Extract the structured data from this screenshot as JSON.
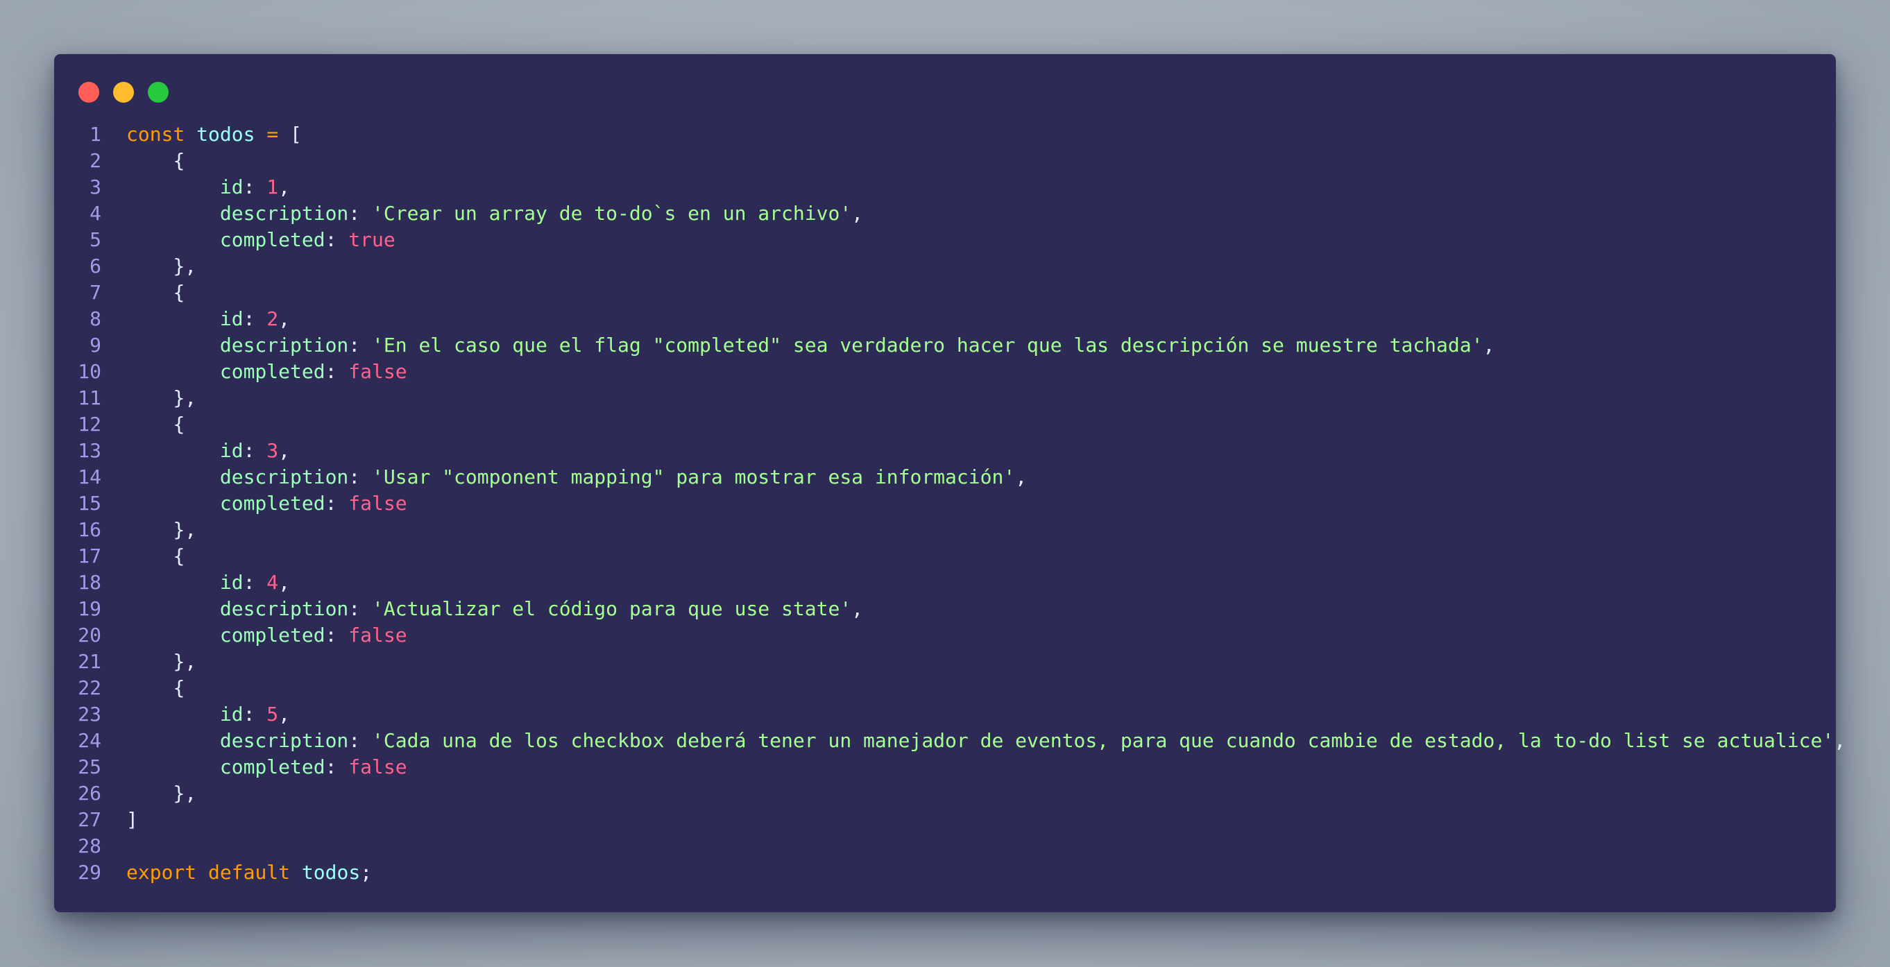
{
  "window": {
    "controls": [
      {
        "name": "close-dot",
        "color": "#ff5f56"
      },
      {
        "name": "minimize-dot",
        "color": "#ffbd2e"
      },
      {
        "name": "maximize-dot",
        "color": "#27c93f"
      }
    ]
  },
  "colors": {
    "background": "#2d2a55",
    "keyword": "#ff9d00",
    "identifier": "#9effff",
    "property": "#9effbb",
    "string": "#a5ff90",
    "number": "#ff628c",
    "line_number": "#a599e9"
  },
  "code": {
    "lines": [
      {
        "n": "1",
        "tokens": [
          [
            "keyword",
            "const"
          ],
          [
            "plain",
            " "
          ],
          [
            "ident",
            "todos"
          ],
          [
            "plain",
            " "
          ],
          [
            "op",
            "="
          ],
          [
            "plain",
            " "
          ],
          [
            "punct",
            "["
          ]
        ]
      },
      {
        "n": "2",
        "tokens": [
          [
            "plain",
            "    "
          ],
          [
            "punct",
            "{"
          ]
        ]
      },
      {
        "n": "3",
        "tokens": [
          [
            "plain",
            "        "
          ],
          [
            "prop",
            "id"
          ],
          [
            "punct",
            ": "
          ],
          [
            "number",
            "1"
          ],
          [
            "punct",
            ","
          ]
        ]
      },
      {
        "n": "4",
        "tokens": [
          [
            "plain",
            "        "
          ],
          [
            "prop",
            "description"
          ],
          [
            "punct",
            ": "
          ],
          [
            "string",
            "'Crear un array de to-do`s en un archivo'"
          ],
          [
            "punct",
            ","
          ]
        ]
      },
      {
        "n": "5",
        "tokens": [
          [
            "plain",
            "        "
          ],
          [
            "prop",
            "completed"
          ],
          [
            "punct",
            ": "
          ],
          [
            "bool",
            "true"
          ]
        ]
      },
      {
        "n": "6",
        "tokens": [
          [
            "plain",
            "    "
          ],
          [
            "punct",
            "},"
          ]
        ]
      },
      {
        "n": "7",
        "tokens": [
          [
            "plain",
            "    "
          ],
          [
            "punct",
            "{"
          ]
        ]
      },
      {
        "n": "8",
        "tokens": [
          [
            "plain",
            "        "
          ],
          [
            "prop",
            "id"
          ],
          [
            "punct",
            ": "
          ],
          [
            "number",
            "2"
          ],
          [
            "punct",
            ","
          ]
        ]
      },
      {
        "n": "9",
        "tokens": [
          [
            "plain",
            "        "
          ],
          [
            "prop",
            "description"
          ],
          [
            "punct",
            ": "
          ],
          [
            "string",
            "'En el caso que el flag \"completed\" sea verdadero hacer que las descripción se muestre tachada'"
          ],
          [
            "punct",
            ","
          ]
        ]
      },
      {
        "n": "10",
        "tokens": [
          [
            "plain",
            "        "
          ],
          [
            "prop",
            "completed"
          ],
          [
            "punct",
            ": "
          ],
          [
            "bool",
            "false"
          ]
        ]
      },
      {
        "n": "11",
        "tokens": [
          [
            "plain",
            "    "
          ],
          [
            "punct",
            "},"
          ]
        ]
      },
      {
        "n": "12",
        "tokens": [
          [
            "plain",
            "    "
          ],
          [
            "punct",
            "{"
          ]
        ]
      },
      {
        "n": "13",
        "tokens": [
          [
            "plain",
            "        "
          ],
          [
            "prop",
            "id"
          ],
          [
            "punct",
            ": "
          ],
          [
            "number",
            "3"
          ],
          [
            "punct",
            ","
          ]
        ]
      },
      {
        "n": "14",
        "tokens": [
          [
            "plain",
            "        "
          ],
          [
            "prop",
            "description"
          ],
          [
            "punct",
            ": "
          ],
          [
            "string",
            "'Usar \"component mapping\" para mostrar esa información'"
          ],
          [
            "punct",
            ","
          ]
        ]
      },
      {
        "n": "15",
        "tokens": [
          [
            "plain",
            "        "
          ],
          [
            "prop",
            "completed"
          ],
          [
            "punct",
            ": "
          ],
          [
            "bool",
            "false"
          ]
        ]
      },
      {
        "n": "16",
        "tokens": [
          [
            "plain",
            "    "
          ],
          [
            "punct",
            "},"
          ]
        ]
      },
      {
        "n": "17",
        "tokens": [
          [
            "plain",
            "    "
          ],
          [
            "punct",
            "{"
          ]
        ]
      },
      {
        "n": "18",
        "tokens": [
          [
            "plain",
            "        "
          ],
          [
            "prop",
            "id"
          ],
          [
            "punct",
            ": "
          ],
          [
            "number",
            "4"
          ],
          [
            "punct",
            ","
          ]
        ]
      },
      {
        "n": "19",
        "tokens": [
          [
            "plain",
            "        "
          ],
          [
            "prop",
            "description"
          ],
          [
            "punct",
            ": "
          ],
          [
            "string",
            "'Actualizar el código para que use state'"
          ],
          [
            "punct",
            ","
          ]
        ]
      },
      {
        "n": "20",
        "tokens": [
          [
            "plain",
            "        "
          ],
          [
            "prop",
            "completed"
          ],
          [
            "punct",
            ": "
          ],
          [
            "bool",
            "false"
          ]
        ]
      },
      {
        "n": "21",
        "tokens": [
          [
            "plain",
            "    "
          ],
          [
            "punct",
            "},"
          ]
        ]
      },
      {
        "n": "22",
        "tokens": [
          [
            "plain",
            "    "
          ],
          [
            "punct",
            "{"
          ]
        ]
      },
      {
        "n": "23",
        "tokens": [
          [
            "plain",
            "        "
          ],
          [
            "prop",
            "id"
          ],
          [
            "punct",
            ": "
          ],
          [
            "number",
            "5"
          ],
          [
            "punct",
            ","
          ]
        ]
      },
      {
        "n": "24",
        "tokens": [
          [
            "plain",
            "        "
          ],
          [
            "prop",
            "description"
          ],
          [
            "punct",
            ": "
          ],
          [
            "string",
            "'Cada una de los checkbox deberá tener un manejador de eventos, para que cuando cambie de estado, la to-do list se actualice'"
          ],
          [
            "punct",
            ","
          ]
        ]
      },
      {
        "n": "25",
        "tokens": [
          [
            "plain",
            "        "
          ],
          [
            "prop",
            "completed"
          ],
          [
            "punct",
            ": "
          ],
          [
            "bool",
            "false"
          ]
        ]
      },
      {
        "n": "26",
        "tokens": [
          [
            "plain",
            "    "
          ],
          [
            "punct",
            "},"
          ]
        ]
      },
      {
        "n": "27",
        "tokens": [
          [
            "punct",
            "]"
          ]
        ]
      },
      {
        "n": "28",
        "tokens": []
      },
      {
        "n": "29",
        "tokens": [
          [
            "keyword",
            "export"
          ],
          [
            "plain",
            " "
          ],
          [
            "keyword",
            "default"
          ],
          [
            "plain",
            " "
          ],
          [
            "ident",
            "todos"
          ],
          [
            "punct",
            ";"
          ]
        ]
      }
    ]
  }
}
